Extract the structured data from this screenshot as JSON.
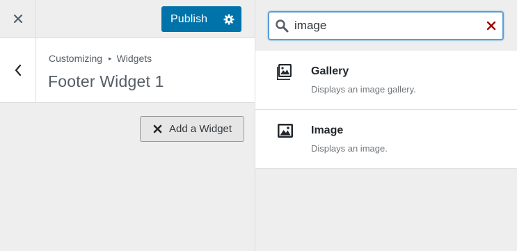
{
  "topbar": {
    "close_icon": "close-icon",
    "publish_label": "Publish",
    "settings_icon": "gear-icon"
  },
  "section": {
    "breadcrumb_root": "Customizing",
    "breadcrumb_separator": "▸",
    "breadcrumb_current": "Widgets",
    "title": "Footer Widget 1",
    "back_icon": "chevron-left-icon"
  },
  "add_widget": {
    "label": "Add a Widget",
    "icon": "close-icon"
  },
  "search": {
    "value": "image",
    "icon": "search-icon",
    "clear_icon": "clear-x-icon"
  },
  "widgets": [
    {
      "title": "Gallery",
      "description": "Displays an image gallery.",
      "icon": "gallery-icon"
    },
    {
      "title": "Image",
      "description": "Displays an image.",
      "icon": "image-icon"
    }
  ],
  "colors": {
    "accent": "#0073aa",
    "focus_border": "#5b9dd9",
    "clear_icon": "#a00000"
  }
}
